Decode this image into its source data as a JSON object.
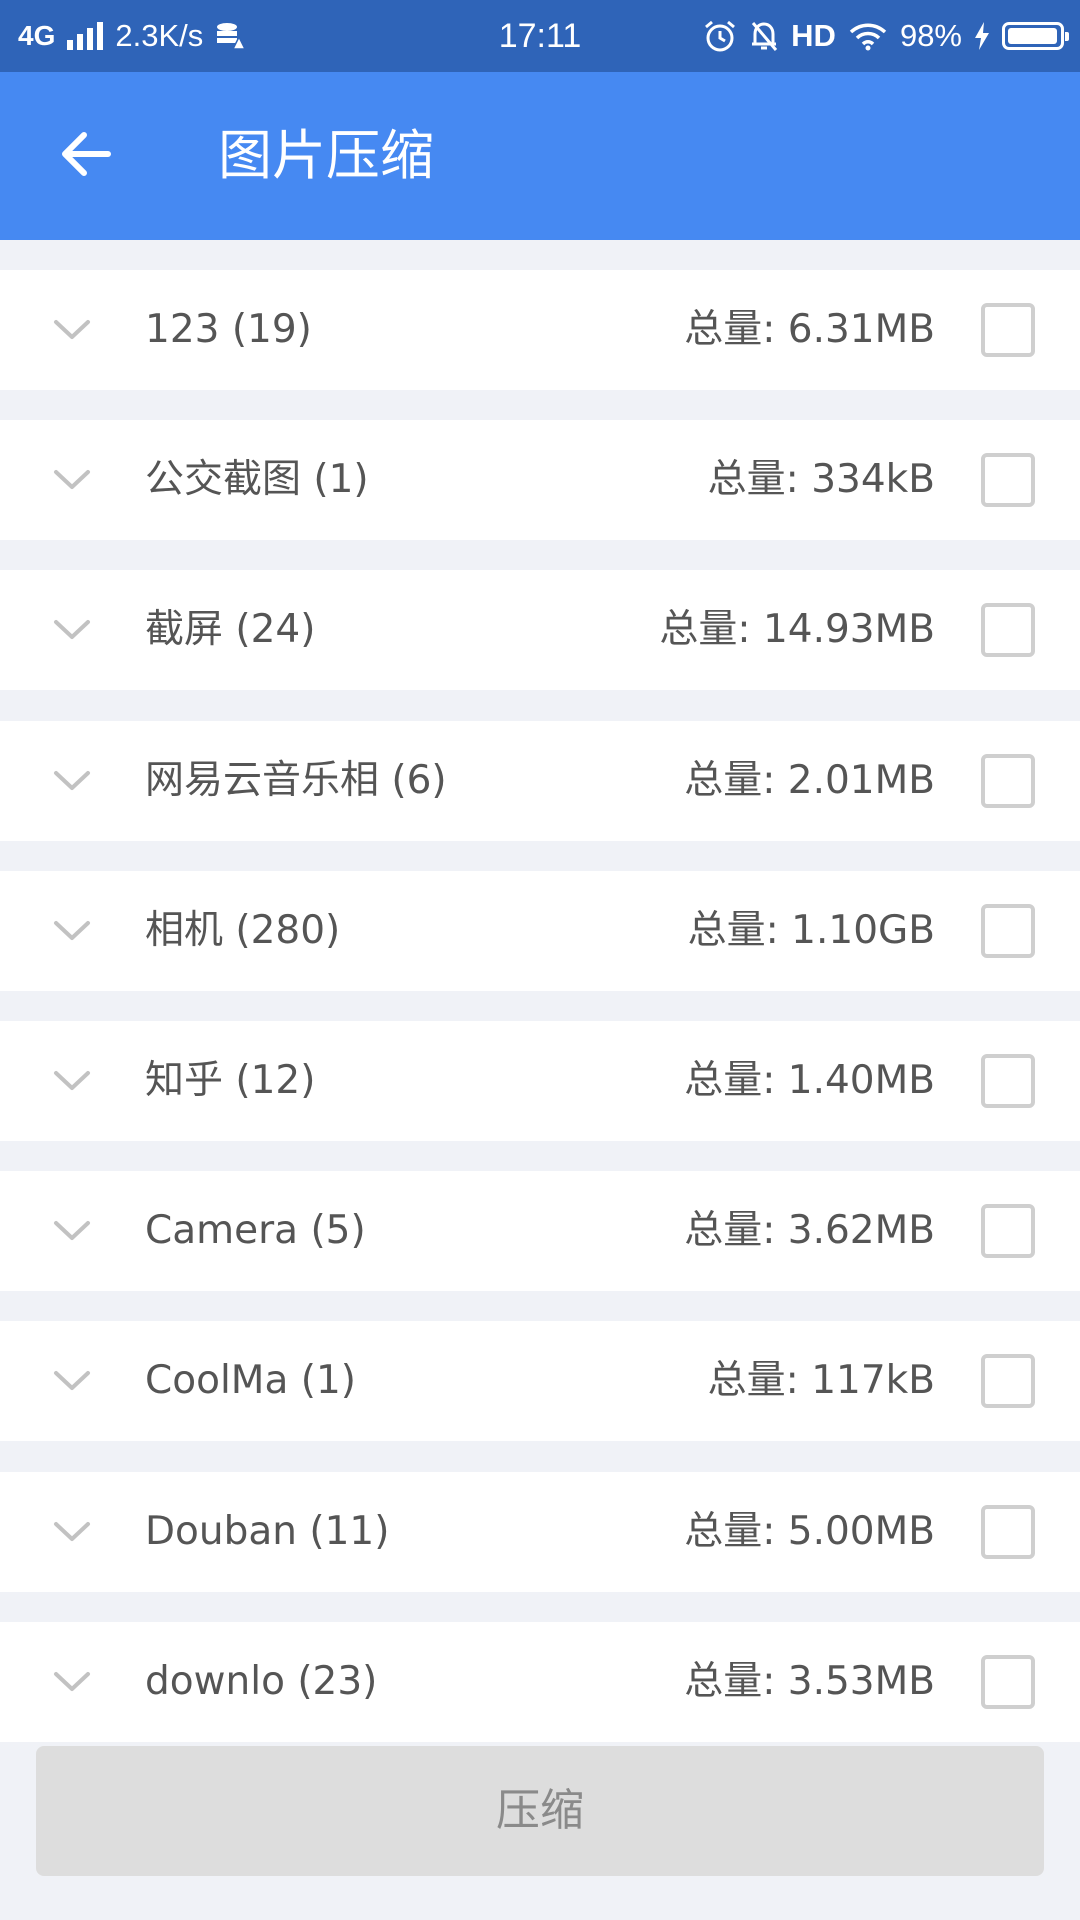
{
  "status_bar": {
    "network": "4G",
    "speed": "2.3K/s",
    "time": "17:11",
    "hd": "HD",
    "battery": "98%",
    "battery_level": 0.98,
    "icons": [
      "signal-bars-icon",
      "data-saver-icon",
      "alarm-icon",
      "bell-off-icon",
      "wifi-icon",
      "charging-bolt-icon",
      "battery-icon"
    ]
  },
  "header": {
    "title": "图片压缩",
    "back_icon": "arrow-left-icon",
    "background": "#4689f2"
  },
  "albums": [
    {
      "name": "123 (19)",
      "total": "总量: 6.31MB",
      "checked": false
    },
    {
      "name": "公交截图 (1)",
      "total": "总量: 334kB",
      "checked": false
    },
    {
      "name": "截屏 (24)",
      "total": "总量: 14.93MB",
      "checked": false
    },
    {
      "name": "网易云音乐相 (6)",
      "total": "总量: 2.01MB",
      "checked": false
    },
    {
      "name": "相机 (280)",
      "total": "总量: 1.10GB",
      "checked": false
    },
    {
      "name": "知乎 (12)",
      "total": "总量: 1.40MB",
      "checked": false
    },
    {
      "name": "Camera (5)",
      "total": "总量: 3.62MB",
      "checked": false
    },
    {
      "name": "CoolMa (1)",
      "total": "总量: 117kB",
      "checked": false
    },
    {
      "name": "Douban (11)",
      "total": "总量: 5.00MB",
      "checked": false
    },
    {
      "name": "downlo (23)",
      "total": "总量: 3.53MB",
      "checked": false
    }
  ],
  "compress_button": {
    "label": "压缩",
    "enabled": false
  }
}
